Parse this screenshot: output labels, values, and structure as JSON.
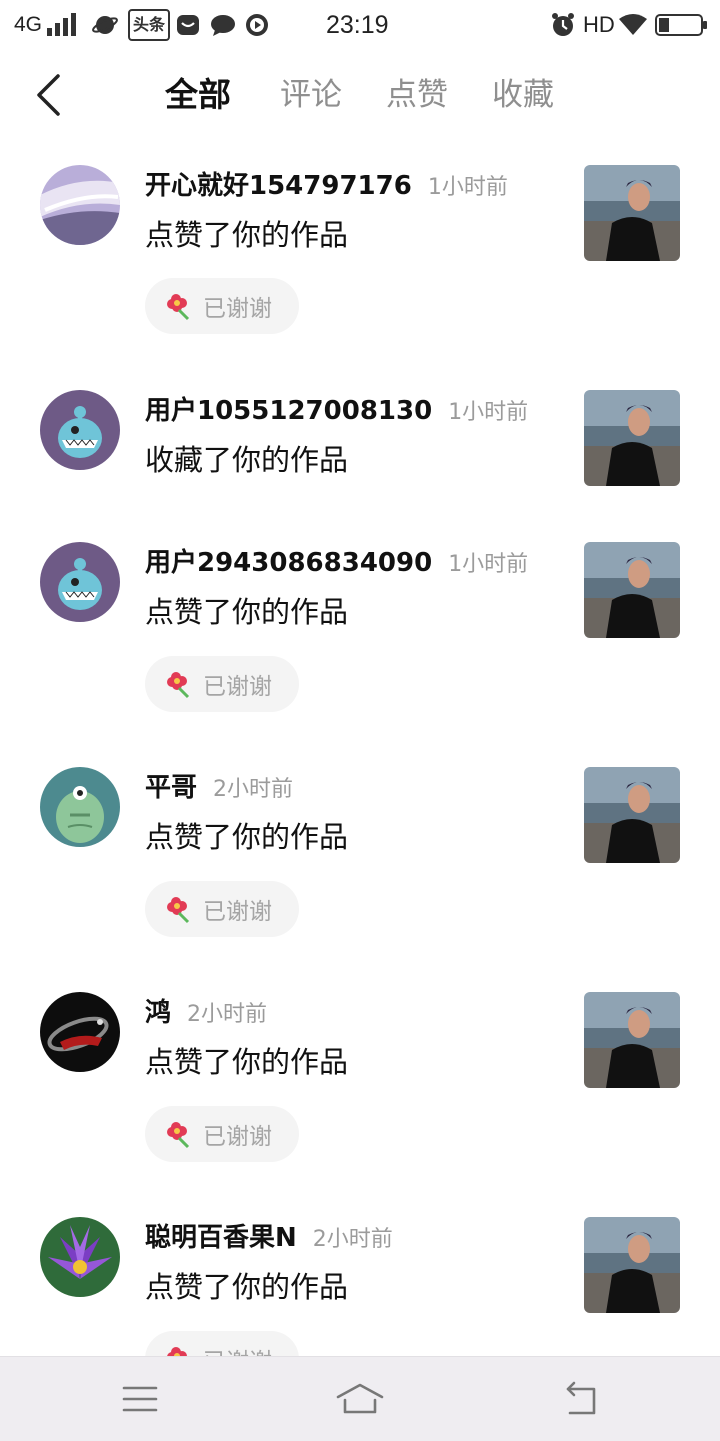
{
  "status_bar": {
    "network": "4G",
    "app_badge": "头条",
    "time": "23:19",
    "hd": "HD"
  },
  "tabs": [
    {
      "label": "全部",
      "active": true
    },
    {
      "label": "评论",
      "active": false
    },
    {
      "label": "点赞",
      "active": false
    },
    {
      "label": "收藏",
      "active": false
    }
  ],
  "thanks_label": "已谢谢",
  "notifications": [
    {
      "username": "开心就好154797176",
      "time": "1小时前",
      "action": "点赞了你的作品",
      "thanked": true,
      "avatar": "abstract-purple-avatar"
    },
    {
      "username": "用户1055127008130",
      "time": "1小时前",
      "action": "收藏了你的作品",
      "thanked": false,
      "avatar": "default-monster-avatar"
    },
    {
      "username": "用户2943086834090",
      "time": "1小时前",
      "action": "点赞了你的作品",
      "thanked": true,
      "avatar": "default-monster-avatar"
    },
    {
      "username": "平哥",
      "time": "2小时前",
      "action": "点赞了你的作品",
      "thanked": true,
      "avatar": "green-monster-avatar"
    },
    {
      "username": "鸿",
      "time": "2小时前",
      "action": "点赞了你的作品",
      "thanked": true,
      "avatar": "dark-bracelet-avatar"
    },
    {
      "username": "聪明百香果N",
      "time": "2小时前",
      "action": "点赞了你的作品",
      "thanked": true,
      "avatar": "purple-lotus-avatar"
    }
  ],
  "colors": {
    "active_tab": "#111111",
    "inactive_tab": "#8f8f8f",
    "time_text": "#9b9b9b",
    "thanks_bg": "#f4f4f4",
    "bottom_bar_bg": "#efedf1"
  },
  "icons": {
    "back": "chevron-left-icon",
    "flower": "flower-icon",
    "menu": "menu-icon",
    "home": "home-icon",
    "return": "return-icon"
  }
}
